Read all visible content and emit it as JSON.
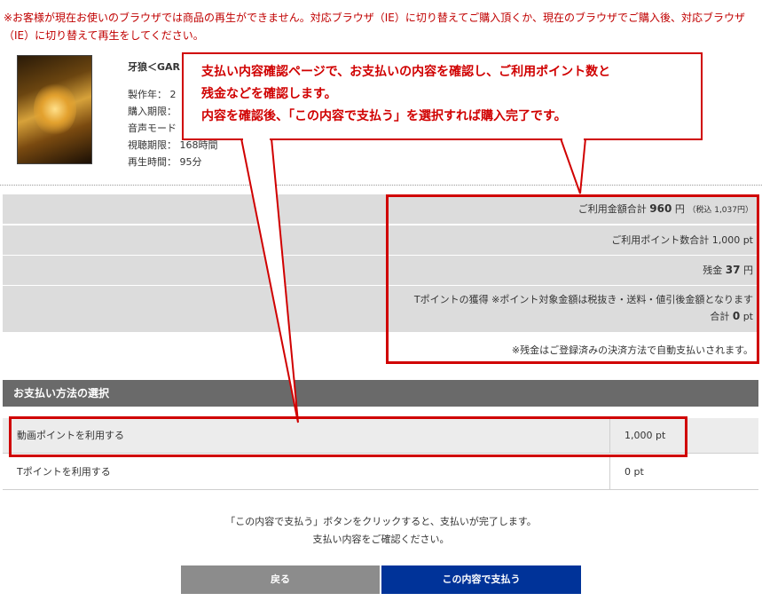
{
  "warning": "※お客様が現在お使いのブラウザでは商品の再生ができません。対応ブラウザ（IE）に切り替えてご購入頂くか、現在のブラウザでご購入後、対応ブラウザ（IE）に切り替えて再生をしてください。",
  "product": {
    "title": "牙狼＜GAR",
    "details": [
      "製作年： 2",
      "購入期限：",
      "音声モード",
      "視聴期限： 168時間",
      "再生時間： 95分"
    ]
  },
  "callout": {
    "line1": "支払い内容確認ページで、お支払いの内容を確認し、ご利用ポイント数と",
    "line2": "残金などを確認します。",
    "line3": "内容を確認後、「この内容で支払う」を選択すれば購入完了です。"
  },
  "summary": {
    "total_label": "ご利用金額合計",
    "total_value": "960",
    "total_unit": "円",
    "total_tax": "（税込 1,037円）",
    "points_label": "ご利用ポイント数合計",
    "points_value": "1,000",
    "points_unit": "pt",
    "balance_label": "残金",
    "balance_value": "37",
    "balance_unit": "円",
    "tpoint_label": "Tポイントの獲得 ※ポイント対象金額は税抜き・送料・値引後金額となります",
    "tpoint_total_label": "合計",
    "tpoint_total_value": "0",
    "tpoint_total_unit": "pt",
    "auto_pay_note": "※残金はご登録済みの決済方法で自動支払いされます。"
  },
  "payment": {
    "header": "お支払い方法の選択",
    "rows": [
      {
        "label": "動画ポイントを利用する",
        "value": "1,000",
        "unit": "pt"
      },
      {
        "label": "Tポイントを利用する",
        "value": "0",
        "unit": "pt"
      }
    ]
  },
  "note": {
    "line1": "「この内容で支払う」ボタンをクリックすると、支払いが完了します。",
    "line2": "支払い内容をご確認ください。"
  },
  "buttons": {
    "back": "戻る",
    "pay": "この内容で支払う"
  },
  "colors": {
    "accent_red": "#d00000",
    "pay_button": "#003399",
    "back_button": "#8c8c8c",
    "section_header": "#6a6a6a"
  }
}
